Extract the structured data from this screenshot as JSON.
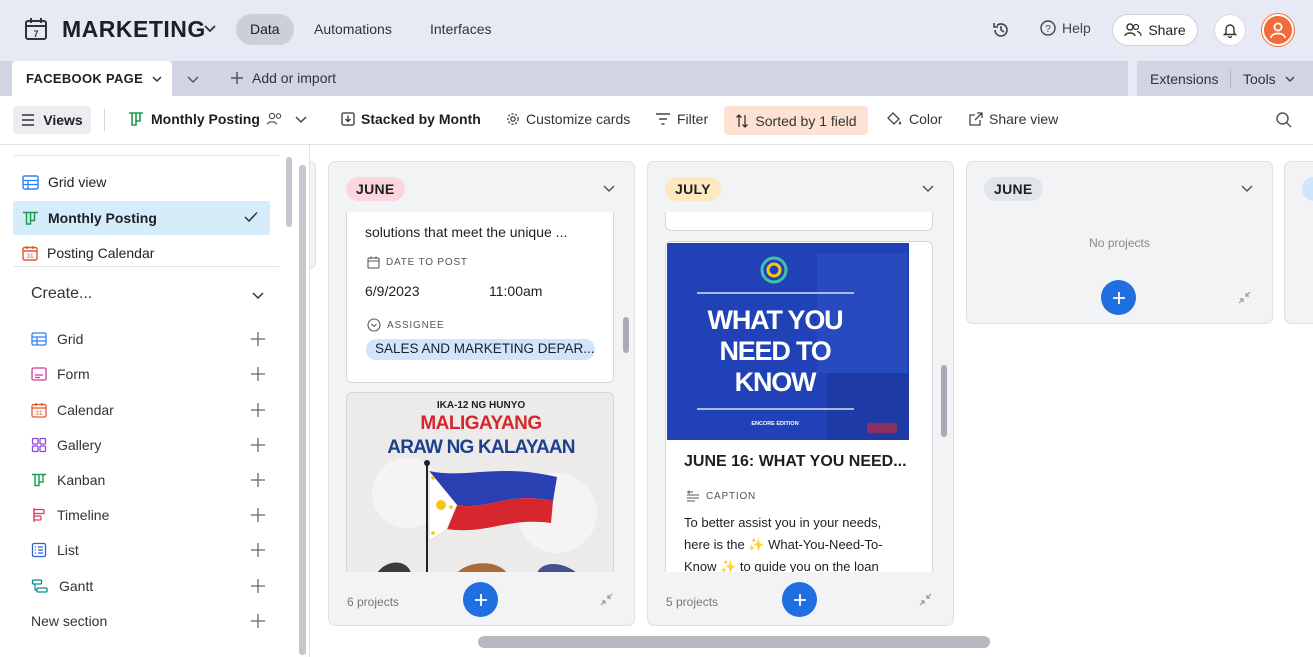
{
  "header": {
    "base_name": "MARKETING",
    "nav_tabs": [
      "Data",
      "Automations",
      "Interfaces"
    ],
    "help_label": "Help",
    "share_label": "Share"
  },
  "tabbar": {
    "table_name": "FACEBOOK PAGE",
    "add_import_label": "Add or import",
    "extensions_label": "Extensions",
    "tools_label": "Tools"
  },
  "toolbar": {
    "views_label": "Views",
    "current_view": "Monthly Posting",
    "stacked_label": "Stacked by Month",
    "customize_label": "Customize cards",
    "filter_label": "Filter",
    "sorted_label": "Sorted by 1 field",
    "color_label": "Color",
    "share_view_label": "Share view"
  },
  "sidebar": {
    "views": [
      {
        "label": "Grid view"
      },
      {
        "label": "Monthly Posting"
      },
      {
        "label": "Posting Calendar"
      }
    ],
    "create_label": "Create...",
    "create_items": [
      {
        "label": "Grid"
      },
      {
        "label": "Form"
      },
      {
        "label": "Calendar"
      },
      {
        "label": "Gallery"
      },
      {
        "label": "Kanban"
      },
      {
        "label": "Timeline"
      },
      {
        "label": "List"
      },
      {
        "label": "Gantt"
      },
      {
        "label": "New section"
      }
    ]
  },
  "board": {
    "stacks": [
      {
        "label": "JUNE",
        "pill_color": "#fbd7dd",
        "count_label": "6 projects",
        "card": {
          "text_fragment": "solutions that meet the unique ...",
          "date_field_label": "DATE TO POST",
          "date_value": "6/9/2023",
          "time_value": "11:00am",
          "assignee_field_label": "ASSIGNEE",
          "assignee_value": "SALES AND MARKETING DEPAR..."
        },
        "image_card": {
          "kicker": "IKA-12 NG HUNYO",
          "line1": "MALIGAYANG",
          "line2": "ARAW NG KALAYAAN"
        }
      },
      {
        "label": "JULY",
        "pill_color": "#fce9bd",
        "count_label": "5 projects",
        "card": {
          "image_title_1": "WHAT YOU",
          "image_title_2": "NEED TO",
          "image_title_3": "KNOW",
          "image_sub": "ENCORE EDITION",
          "title": "JUNE 16: WHAT YOU NEED...",
          "caption_label": "CAPTION",
          "caption_line1": "To better assist you in your needs,",
          "caption_line2": "here is the ✨ What-You-Need-To-",
          "caption_line3": "Know ✨ to guide you on the loan"
        }
      },
      {
        "label": "JUNE",
        "pill_color": "#e3e5ec",
        "empty_label": "No projects"
      }
    ]
  }
}
